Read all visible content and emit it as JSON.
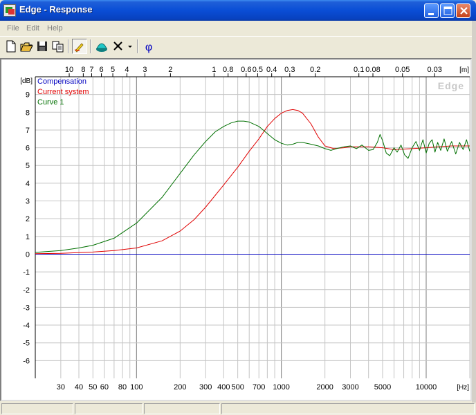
{
  "window": {
    "title": "Edge - Response"
  },
  "menu": {
    "items": [
      "File",
      "Edit",
      "Help"
    ]
  },
  "toolbar": {
    "buttons": [
      "new-file-icon",
      "open-folder-icon",
      "save-disk-icon",
      "copy-icon",
      "pen-icon",
      "speaker-icon",
      "delete-x-icon",
      "dropdown-arrow-icon",
      "phase-icon"
    ],
    "phase_label": "φ"
  },
  "chart_data": {
    "type": "line",
    "watermark": "Edge",
    "ylabel": "[dB]",
    "xlabel": "[Hz]",
    "top_axis_label": "[m]",
    "x_scale": "log",
    "xlim": [
      20,
      20000
    ],
    "ylim": [
      -7,
      10
    ],
    "grid": true,
    "legend_position": "top-left",
    "y_ticks": [
      9,
      8,
      7,
      6,
      5,
      4,
      3,
      2,
      1,
      0,
      -1,
      -2,
      -3,
      -4,
      -5,
      -6
    ],
    "x_ticks": [
      {
        "value": 30,
        "label": "30"
      },
      {
        "value": 40,
        "label": "40"
      },
      {
        "value": 50,
        "label": "50"
      },
      {
        "value": 60,
        "label": "60"
      },
      {
        "value": 80,
        "label": "80"
      },
      {
        "value": 100,
        "label": "100"
      },
      {
        "value": 200,
        "label": "200"
      },
      {
        "value": 300,
        "label": "300"
      },
      {
        "value": 400,
        "label": "400"
      },
      {
        "value": 500,
        "label": "500"
      },
      {
        "value": 700,
        "label": "700"
      },
      {
        "value": 1000,
        "label": "1000"
      },
      {
        "value": 2000,
        "label": "2000"
      },
      {
        "value": 3000,
        "label": "3000"
      },
      {
        "value": 5000,
        "label": "5000"
      },
      {
        "value": 10000,
        "label": "10000"
      }
    ],
    "top_ticks": [
      {
        "label": "10",
        "hz": 34.3
      },
      {
        "label": "8",
        "hz": 42.9
      },
      {
        "label": "7",
        "hz": 49.0
      },
      {
        "label": "6",
        "hz": 57.2
      },
      {
        "label": "5",
        "hz": 68.6
      },
      {
        "label": "4",
        "hz": 85.8
      },
      {
        "label": "3",
        "hz": 114.3
      },
      {
        "label": "2",
        "hz": 171.5
      },
      {
        "label": "1",
        "hz": 343
      },
      {
        "label": "0.8",
        "hz": 428.8
      },
      {
        "label": "0.6",
        "hz": 571.7
      },
      {
        "label": "0.5",
        "hz": 686
      },
      {
        "label": "0.4",
        "hz": 857.5
      },
      {
        "label": "0.3",
        "hz": 1143.3
      },
      {
        "label": "0.2",
        "hz": 1715
      },
      {
        "label": "0.1",
        "hz": 3430
      },
      {
        "label": "0.08",
        "hz": 4287.5
      },
      {
        "label": "0.05",
        "hz": 6860
      },
      {
        "label": "0.03",
        "hz": 11433
      }
    ],
    "series": [
      {
        "name": "Compensation",
        "color": "#0000c0",
        "points": [
          [
            20,
            0
          ],
          [
            20000,
            0
          ]
        ]
      },
      {
        "name": "Current system",
        "color": "#e00000",
        "points": [
          [
            20,
            0.03
          ],
          [
            30,
            0.05
          ],
          [
            50,
            0.12
          ],
          [
            70,
            0.2
          ],
          [
            100,
            0.35
          ],
          [
            150,
            0.75
          ],
          [
            200,
            1.3
          ],
          [
            250,
            1.95
          ],
          [
            300,
            2.65
          ],
          [
            400,
            3.9
          ],
          [
            500,
            4.9
          ],
          [
            600,
            5.8
          ],
          [
            700,
            6.5
          ],
          [
            800,
            7.2
          ],
          [
            900,
            7.65
          ],
          [
            1000,
            7.95
          ],
          [
            1100,
            8.1
          ],
          [
            1200,
            8.15
          ],
          [
            1300,
            8.1
          ],
          [
            1400,
            7.95
          ],
          [
            1600,
            7.35
          ],
          [
            1800,
            6.6
          ],
          [
            2000,
            6.1
          ],
          [
            2300,
            5.95
          ],
          [
            2700,
            6.0
          ],
          [
            3000,
            6.05
          ],
          [
            4000,
            6.05
          ],
          [
            5000,
            6.0
          ],
          [
            6000,
            5.9
          ],
          [
            8000,
            5.95
          ],
          [
            10000,
            6.0
          ],
          [
            12000,
            6.05
          ],
          [
            15000,
            6.1
          ],
          [
            20000,
            6.1
          ]
        ]
      },
      {
        "name": "Curve 1",
        "color": "#007000",
        "points": [
          [
            20,
            0.1
          ],
          [
            30,
            0.2
          ],
          [
            40,
            0.35
          ],
          [
            50,
            0.5
          ],
          [
            70,
            0.9
          ],
          [
            100,
            1.75
          ],
          [
            150,
            3.2
          ],
          [
            200,
            4.55
          ],
          [
            250,
            5.6
          ],
          [
            300,
            6.35
          ],
          [
            350,
            6.9
          ],
          [
            400,
            7.2
          ],
          [
            450,
            7.4
          ],
          [
            500,
            7.5
          ],
          [
            550,
            7.5
          ],
          [
            600,
            7.45
          ],
          [
            700,
            7.2
          ],
          [
            800,
            6.8
          ],
          [
            900,
            6.45
          ],
          [
            1000,
            6.25
          ],
          [
            1100,
            6.15
          ],
          [
            1200,
            6.2
          ],
          [
            1300,
            6.3
          ],
          [
            1400,
            6.3
          ],
          [
            1600,
            6.2
          ],
          [
            1800,
            6.1
          ],
          [
            2000,
            5.95
          ],
          [
            2200,
            5.85
          ],
          [
            2400,
            5.95
          ],
          [
            2700,
            6.05
          ],
          [
            3000,
            6.1
          ],
          [
            3300,
            5.95
          ],
          [
            3600,
            6.15
          ],
          [
            4000,
            5.85
          ],
          [
            4300,
            5.9
          ],
          [
            4600,
            6.3
          ],
          [
            4800,
            6.75
          ],
          [
            5000,
            6.4
          ],
          [
            5300,
            5.7
          ],
          [
            5600,
            5.55
          ],
          [
            6000,
            6.0
          ],
          [
            6300,
            5.75
          ],
          [
            6700,
            6.15
          ],
          [
            7100,
            5.6
          ],
          [
            7500,
            5.4
          ],
          [
            8000,
            6.0
          ],
          [
            8500,
            6.35
          ],
          [
            9000,
            5.85
          ],
          [
            9500,
            6.45
          ],
          [
            10000,
            5.7
          ],
          [
            10500,
            6.25
          ],
          [
            11000,
            6.45
          ],
          [
            11500,
            5.75
          ],
          [
            12000,
            6.3
          ],
          [
            12600,
            5.85
          ],
          [
            13300,
            6.5
          ],
          [
            14000,
            5.8
          ],
          [
            15000,
            6.35
          ],
          [
            16000,
            5.65
          ],
          [
            17000,
            6.3
          ],
          [
            18000,
            5.9
          ],
          [
            19000,
            6.45
          ],
          [
            20000,
            5.8
          ]
        ]
      }
    ]
  }
}
